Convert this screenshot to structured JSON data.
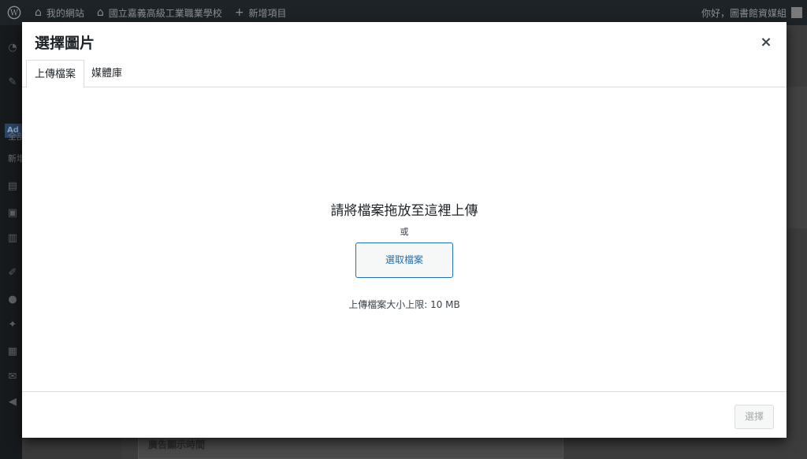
{
  "adminbar": {
    "site_name": "我的網站",
    "school_name": "國立嘉義高級工業職業學校",
    "new_item": "新增項目",
    "greeting": "你好，圖書館資媒組"
  },
  "sidebar": {
    "badge": "Ad",
    "text1": "全部",
    "text2": "新增"
  },
  "background": {
    "panel_title": "廣告顯示時間"
  },
  "modal": {
    "title": "選擇圖片",
    "close_label": "×",
    "tabs": [
      {
        "label": "上傳檔案",
        "active": true
      },
      {
        "label": "媒體庫",
        "active": false
      }
    ],
    "uploader": {
      "drop_instructions": "請將檔案拖放至這裡上傳",
      "or_label": "或",
      "select_files_label": "選取檔案",
      "max_size_label": "上傳檔案大小上限: 10 MB"
    },
    "footer": {
      "select_button_label": "選擇"
    }
  },
  "colors": {
    "accent": "#2271b1",
    "adminbar_bg": "#1d2327",
    "overlay": "#3a3a3a"
  }
}
